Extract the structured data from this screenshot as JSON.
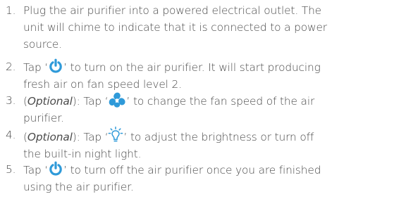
{
  "steps": [
    {
      "number": "1.",
      "lines": [
        "Plug the air purifier into a powered electrical outlet. The",
        "unit will chime to indicate that it is connected to a power",
        "source."
      ]
    },
    {
      "number": "2.",
      "before": "Tap ‘",
      "icon": "power-icon",
      "after": "’ to turn on the air purifier. It will start producing",
      "line2": "fresh air on fan speed level 2."
    },
    {
      "number": "3.",
      "open": "(",
      "emphasis": "Optional",
      "close": "): Tap ‘",
      "icon": "fan-icon",
      "after": "’ to change the fan speed of the air",
      "line2": "purifier."
    },
    {
      "number": "4.",
      "open": "(",
      "emphasis": "Optional",
      "close": "): Tap ‘",
      "icon": "night-light-icon",
      "after": "’ to adjust the brightness or turn off",
      "line2": "the built-in night light."
    },
    {
      "number": "5.",
      "before": "Tap ‘",
      "icon": "power-icon",
      "after": "’ to turn off the air purifier once you are finished",
      "line2": "using the air purifier."
    }
  ],
  "colors": {
    "text": "#4a4a4a",
    "accent": "#2f9ad9"
  }
}
